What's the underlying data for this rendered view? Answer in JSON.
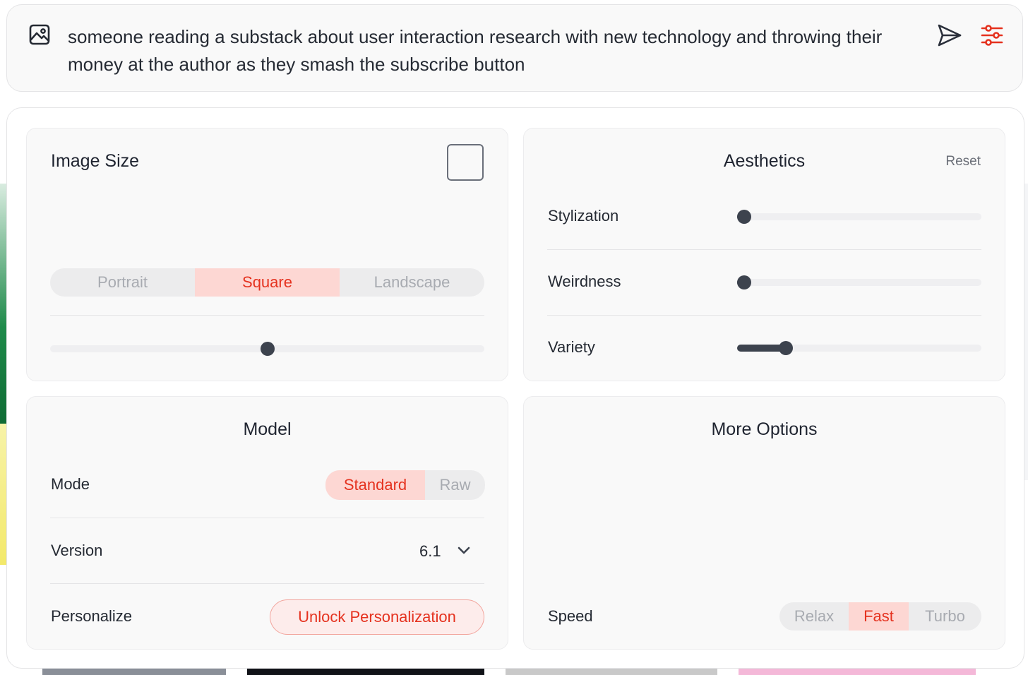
{
  "prompt": {
    "text": "someone reading a substack about user interaction research with new technology and throwing their money at the author as they smash the subscribe button"
  },
  "image_size": {
    "title": "Image Size",
    "orientation_options": [
      "Portrait",
      "Square",
      "Landscape"
    ],
    "selected_orientation": "Square",
    "aspect_slider_value": 0.5
  },
  "aesthetics": {
    "title": "Aesthetics",
    "reset_label": "Reset",
    "sliders": [
      {
        "label": "Stylization",
        "value": 0.03
      },
      {
        "label": "Weirdness",
        "value": 0.03
      },
      {
        "label": "Variety",
        "value": 0.2
      }
    ]
  },
  "model": {
    "title": "Model",
    "mode_label": "Mode",
    "mode_options": [
      "Standard",
      "Raw"
    ],
    "selected_mode": "Standard",
    "version_label": "Version",
    "version_value": "6.1",
    "personalize_label": "Personalize",
    "unlock_label": "Unlock Personalization"
  },
  "more_options": {
    "title": "More Options",
    "speed_label": "Speed",
    "speed_options": [
      "Relax",
      "Fast",
      "Turbo"
    ],
    "selected_speed": "Fast"
  },
  "colors": {
    "accent": "#e5321f",
    "accent_bg": "#fdd7d3",
    "slider": "#3d434e"
  }
}
